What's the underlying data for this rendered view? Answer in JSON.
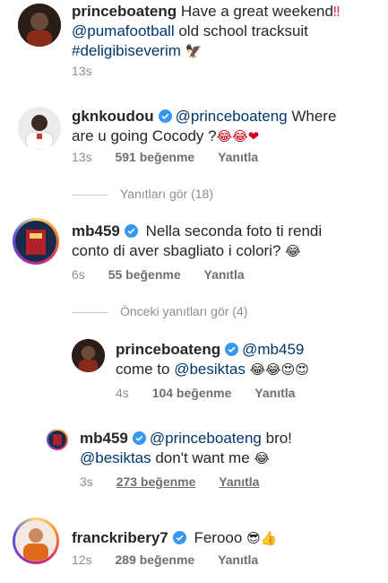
{
  "comments": [
    {
      "user": "princeboateng",
      "verified": false,
      "text_line1": " Have a great weekend",
      "text_line1_emoji": "‼",
      "mention": "@pumafootball",
      "text_line2_rest": " old school tracksuit",
      "hashtag": "#deligibiseverim",
      "hashtag_emoji": "🦅",
      "time": "13s"
    },
    {
      "user": "gknkoudou",
      "verified": true,
      "mention": "@princeboateng",
      "text_line1_rest": " Where",
      "text_line2": "are u going Cocody ?",
      "emojis": "😂😂❤",
      "time": "13s",
      "likes": "591 beğenme",
      "reply_label": "Yanıtla"
    },
    {
      "user": "mb459",
      "verified": true,
      "text_line1": " Nella seconda foto ti rendi",
      "text_line2": "conto di aver sbagliato i colori?",
      "emojis": "😂",
      "time": "6s",
      "likes": "55 beğenme",
      "reply_label": "Yanıtla"
    },
    {
      "user": "princeboateng",
      "verified": true,
      "mention": "@mb459",
      "text_line2_pre": "come to ",
      "mention2": "@besiktas",
      "emojis": "😂😂😍😍",
      "time": "4s",
      "likes": "104 beğenme",
      "reply_label": "Yanıtla"
    },
    {
      "user": "mb459",
      "verified": true,
      "mention": "@princeboateng",
      "text_line1_rest": " bro!",
      "mention2": "@besiktas",
      "text_line2_rest": " don't want me",
      "emojis": "😂",
      "time": "3s",
      "likes": "273 beğenme",
      "reply_label": "Yanıtla"
    },
    {
      "user": "franckribery7",
      "verified": true,
      "text_line1": " Ferooo",
      "emojis": "😎👍",
      "time": "12s",
      "likes": "289 beğenme",
      "reply_label": "Yanıtla"
    }
  ],
  "view_replies_1": "Yanıtları gör (18)",
  "view_replies_2": "Önceki yanıtları gör (4)",
  "colors": {
    "text": "#262626",
    "mention": "#00376b",
    "secondary": "#8e8e8e",
    "verified": "#3897f0"
  }
}
